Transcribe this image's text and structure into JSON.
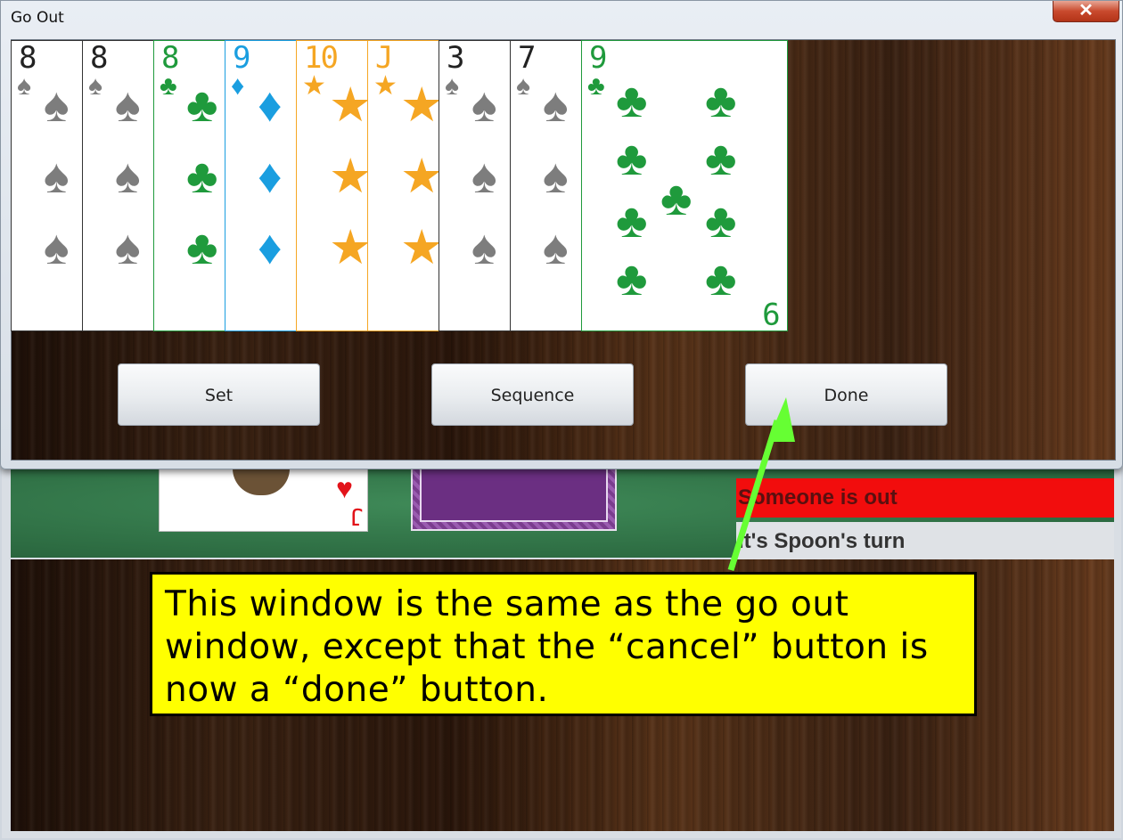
{
  "dialog": {
    "title": "Go Out",
    "close_label": "✕"
  },
  "cards": [
    {
      "rank": "8",
      "suit": "♠",
      "color": "#7d7d7d"
    },
    {
      "rank": "8",
      "suit": "♠",
      "color": "#7d7d7d"
    },
    {
      "rank": "8",
      "suit": "♣",
      "color": "#1f9a3c"
    },
    {
      "rank": "9",
      "suit": "♦",
      "color": "#1a9ee0"
    },
    {
      "rank": "10",
      "suit": "★",
      "color": "#f5a623"
    },
    {
      "rank": "J",
      "suit": "★",
      "color": "#f5a623"
    },
    {
      "rank": "3",
      "suit": "♠",
      "color": "#7d7d7d"
    },
    {
      "rank": "7",
      "suit": "♠",
      "color": "#7d7d7d"
    },
    {
      "rank": "9",
      "suit": "♣",
      "color": "#1f9a3c"
    }
  ],
  "buttons": {
    "set": "Set",
    "sequence": "Sequence",
    "done": "Done"
  },
  "background": {
    "status_out": "Someone is out",
    "status_turn": "It's Spoon's turn",
    "peek_card_rank": "J",
    "peek_card_suit": "♥"
  },
  "annotation": {
    "text": "This window is the same as the go out window, except that the “cancel” button is now a “done” button.",
    "arrow_color": "#66ff33"
  }
}
